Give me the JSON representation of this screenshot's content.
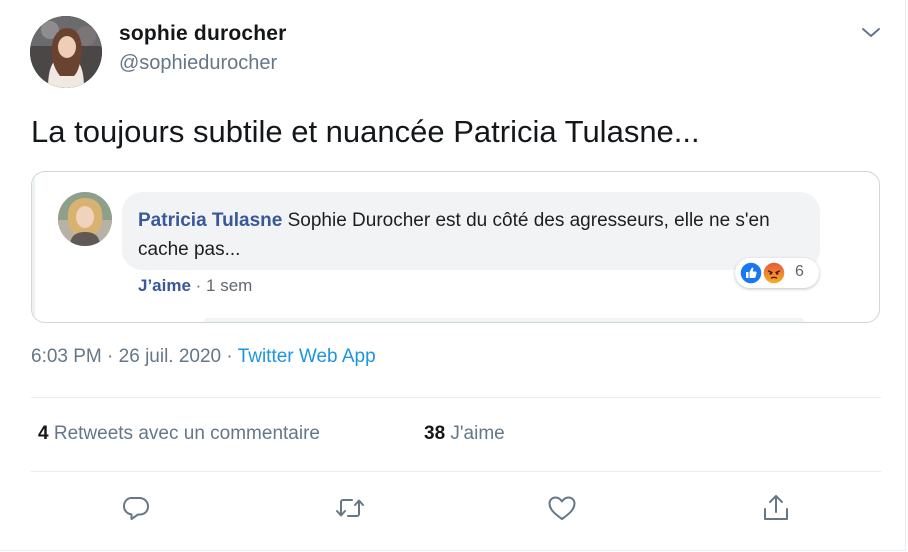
{
  "author": {
    "name": "sophie durocher",
    "handle": "@sophiedurocher"
  },
  "tweet": {
    "text": "La toujours subtile et nuancée Patricia Tulasne..."
  },
  "embedded_comment": {
    "commenter_name": "Patricia Tulasne",
    "comment_text": " Sophie Durocher est du côté des agresseurs, elle ne s'en cache pas...",
    "like_label": "J’aime",
    "separator": " · ",
    "age": "1 sem",
    "reaction_count": "6",
    "reaction_icons": [
      "like-reaction-icon",
      "angry-reaction-icon"
    ]
  },
  "meta": {
    "time": "6:03 PM",
    "date": "26 juil. 2020",
    "dot": " · ",
    "app": "Twitter Web App"
  },
  "stats": {
    "retweets_count": "4",
    "retweets_label": " Retweets avec un commentaire",
    "likes_count": "38",
    "likes_label": " J'aime"
  },
  "actions": [
    "reply-icon",
    "retweet-icon",
    "like-icon",
    "share-icon"
  ],
  "colors": {
    "link_blue": "#1b95e0",
    "facebook_name": "#385898",
    "secondary_text": "#657786",
    "bubble_bg": "#f2f3f5"
  }
}
